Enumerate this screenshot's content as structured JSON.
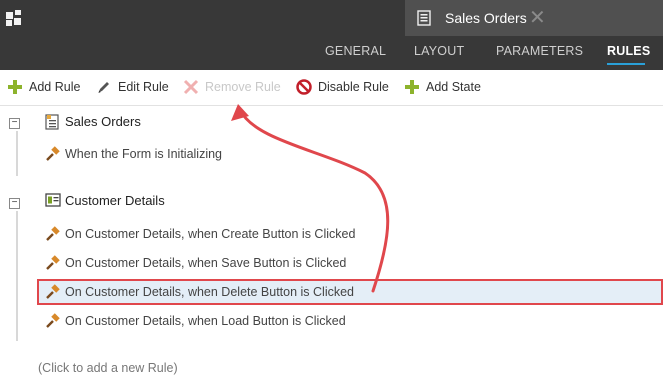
{
  "header": {
    "document_tab": {
      "title": "Sales Orders",
      "icon": "form-icon",
      "close_icon": "close-icon"
    },
    "nav_tabs": [
      {
        "label": "GENERAL",
        "active": false
      },
      {
        "label": "LAYOUT",
        "active": false
      },
      {
        "label": "PARAMETERS",
        "active": false
      },
      {
        "label": "RULES",
        "active": true
      }
    ]
  },
  "toolbar": {
    "add_rule": "Add Rule",
    "edit_rule": "Edit Rule",
    "remove_rule": "Remove Rule",
    "disable_rule": "Disable Rule",
    "add_state": "Add State"
  },
  "groups": [
    {
      "title": "Sales Orders",
      "icon": "form-icon",
      "rules": [
        "When the Form is Initializing"
      ]
    },
    {
      "title": "Customer Details",
      "icon": "view-icon",
      "rules": [
        "On Customer Details, when Create Button is Clicked",
        "On Customer Details, when Save Button is Clicked",
        "On Customer Details, when Delete Button is Clicked",
        "On Customer Details, when Load Button is Clicked"
      ]
    }
  ],
  "selected_rule": "On Customer Details, when Delete Button is Clicked",
  "add_rule_hint": "(Click to add a new Rule)",
  "colors": {
    "accent": "#2aa0d8",
    "highlight": "#e0474c",
    "header_bg": "#383838"
  }
}
